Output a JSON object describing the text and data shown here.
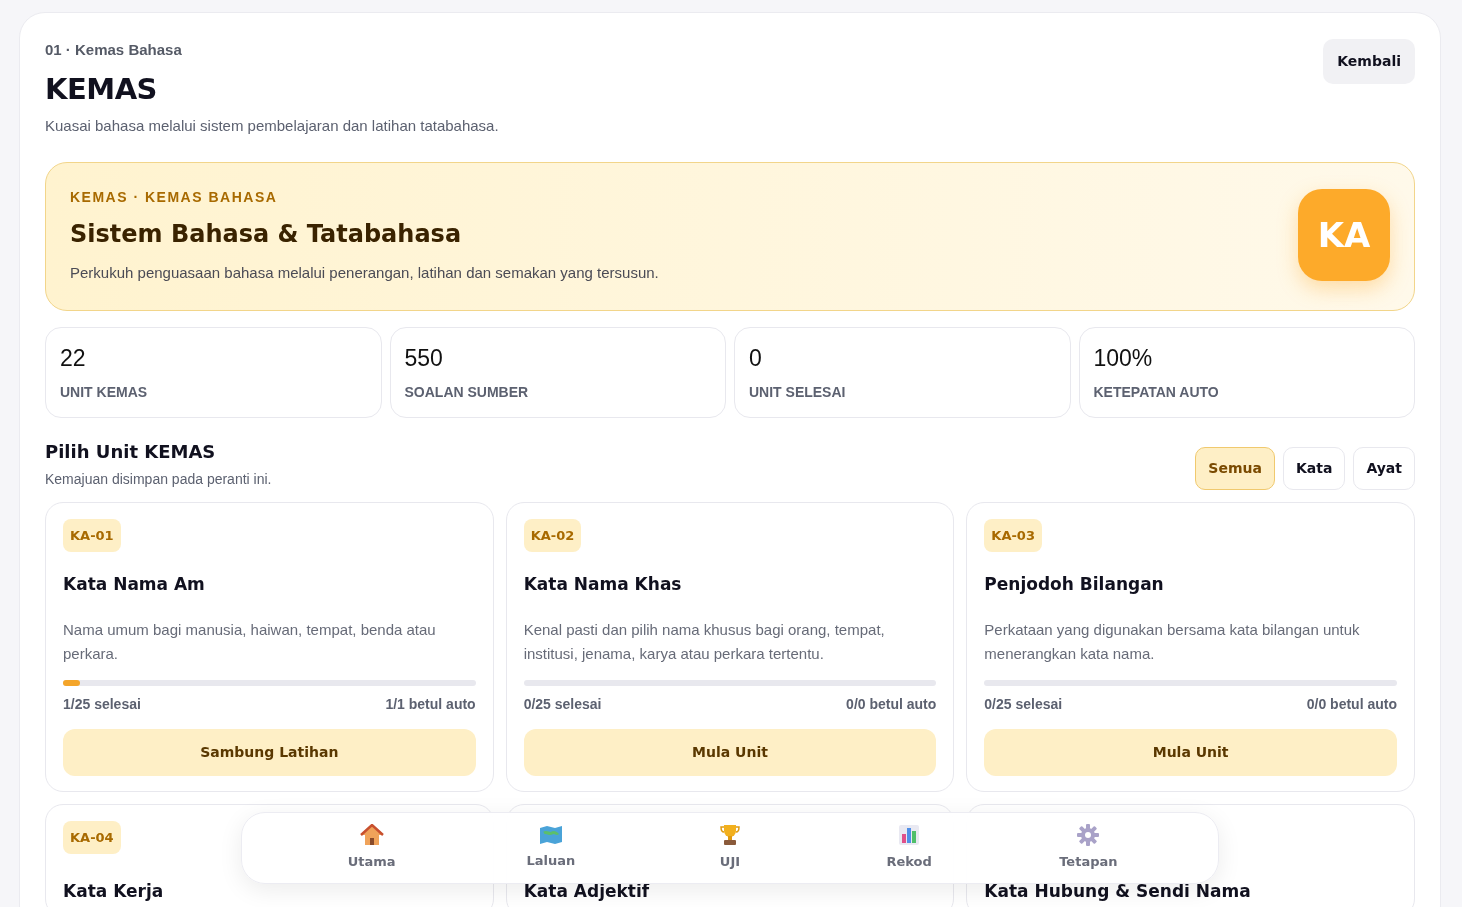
{
  "header": {
    "eyebrow": "01 · Kemas Bahasa",
    "title": "KEMAS",
    "subtitle": "Kuasai bahasa melalui sistem pembelajaran dan latihan tatabahasa.",
    "back_button": "Kembali"
  },
  "hero": {
    "eyebrow": "KEMAS · KEMAS BAHASA",
    "title": "Sistem Bahasa & Tatabahasa",
    "description": "Perkukuh penguasaan bahasa melalui penerangan, latihan dan semakan yang tersusun.",
    "badge": "KA"
  },
  "stats": [
    {
      "value": "22",
      "label": "UNIT KEMAS"
    },
    {
      "value": "550",
      "label": "SOALAN SUMBER"
    },
    {
      "value": "0",
      "label": "UNIT SELESAI"
    },
    {
      "value": "100%",
      "label": "KETEPATAN AUTO"
    }
  ],
  "units_section": {
    "title": "Pilih Unit KEMAS",
    "subtitle": "Kemajuan disimpan pada peranti ini.",
    "filters": [
      {
        "label": "Semua",
        "selected": true
      },
      {
        "label": "Kata",
        "selected": false
      },
      {
        "label": "Ayat",
        "selected": false
      }
    ]
  },
  "units": [
    {
      "code": "KA-01",
      "title": "Kata Nama Am",
      "description": "Nama umum bagi manusia, haiwan, tempat, benda atau perkara.",
      "level": 0.04,
      "progress": "1/25 selesai",
      "score": "1/1 betul auto",
      "button": "Sambung Latihan"
    },
    {
      "code": "KA-02",
      "title": "Kata Nama Khas",
      "description": "Kenal pasti dan pilih nama khusus bagi orang, tempat, institusi, jenama, karya atau perkara tertentu.",
      "level": 0,
      "progress": "0/25 selesai",
      "score": "0/0 betul auto",
      "button": "Mula Unit"
    },
    {
      "code": "KA-03",
      "title": "Penjodoh Bilangan",
      "description": "Perkataan yang digunakan bersama kata bilangan untuk menerangkan kata nama.",
      "level": 0,
      "progress": "0/25 selesai",
      "score": "0/0 betul auto",
      "button": "Mula Unit"
    },
    {
      "code": "KA-04",
      "title": "Kata Kerja"
    },
    {
      "title": "Kata Adjektif"
    },
    {
      "title": "Kata Hubung & Sendi Nama"
    }
  ],
  "bottom_nav": [
    {
      "kind": "home",
      "label": "Utama"
    },
    {
      "kind": "map",
      "label": "Laluan"
    },
    {
      "kind": "trophy",
      "label": "UJI"
    },
    {
      "kind": "chart",
      "label": "Rekod"
    },
    {
      "kind": "gear",
      "label": "Tetapan"
    }
  ]
}
